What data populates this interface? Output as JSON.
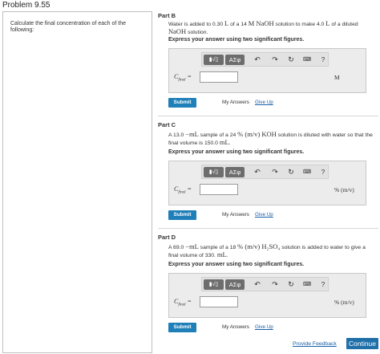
{
  "problem": {
    "title": "Problem 9.55",
    "instructions": "Calculate the final concentration of each of the following:"
  },
  "common": {
    "express_instruction": "Express your answer using two significant figures.",
    "template_btn": "▮√▯",
    "symbol_btn": "ΑΣφ",
    "undo_icon": "↶",
    "redo_icon": "↷",
    "reset_icon": "↻",
    "keyboard_icon": "⌨",
    "help_icon": "?",
    "variable_label_main": "C",
    "variable_label_sub": "final",
    "equals": "=",
    "submit_label": "Submit",
    "my_answers_label": "My Answers",
    "give_up_label": "Give Up"
  },
  "parts": [
    {
      "label": "Part B",
      "text_a": "Water is added to 0.30 ",
      "text_b": "L",
      "text_c": " of a 14 ",
      "text_d": "M NaOH",
      "text_e": " solution to make 4.0 ",
      "text_f": "L",
      "text_g": " of a diluted",
      "text_h": "NaOH",
      "text_i": " solution.",
      "unit": "M",
      "answer_value": ""
    },
    {
      "label": "Part C",
      "text_a": "A 13.0 ",
      "text_b": "−mL",
      "text_c": " sample of a 24 ",
      "text_d": "% (m/v) KOH",
      "text_e": " solution is diluted with water so that the",
      "text_f": "final volume is 150.0 ",
      "text_g": "mL",
      "text_h": ".",
      "unit": "% (m/v)",
      "answer_value": ""
    },
    {
      "label": "Part D",
      "text_a": "A 69.0 ",
      "text_b": "−mL",
      "text_c": " sample of a 18 ",
      "text_d": "% (m/v) H₂SO₄",
      "text_e": " solution is added to water to give a",
      "text_f": "final volume of 330. ",
      "text_g": "mL",
      "text_h": ".",
      "unit": "% (m/v)",
      "answer_value": ""
    }
  ],
  "footer": {
    "feedback_label": "Provide Feedback",
    "continue_label": "Continue"
  },
  "colors": {
    "submit": "#1f7fb8",
    "continue": "#1f6fa8",
    "link": "#1a5ea8"
  }
}
